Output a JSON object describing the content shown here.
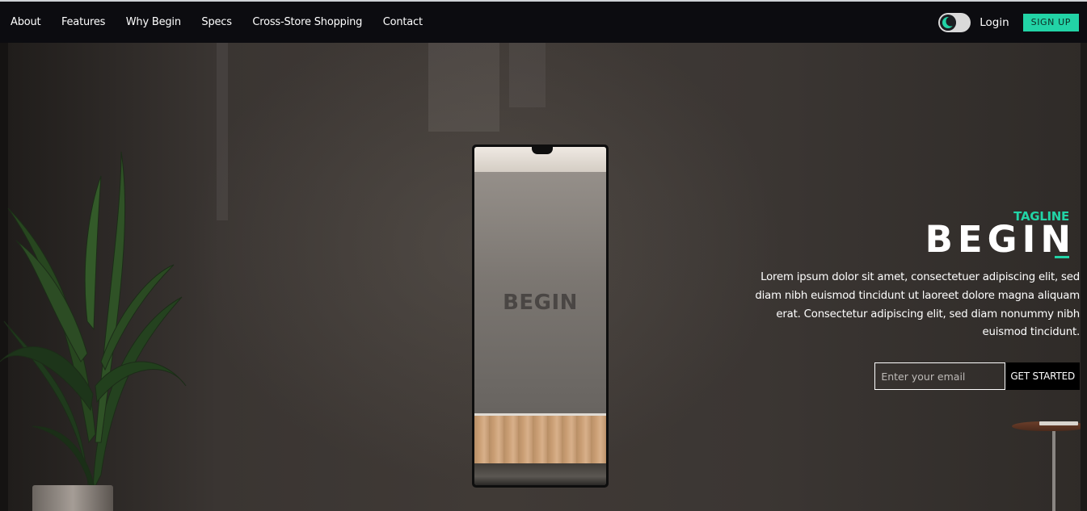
{
  "nav": {
    "links": [
      "About",
      "Features",
      "Why Begin",
      "Specs",
      "Cross-Store Shopping",
      "Contact"
    ],
    "login_label": "Login",
    "signup_label": "SIGN UP",
    "theme_toggle_icon": "moon-icon",
    "accent_color": "#22d3a6"
  },
  "hero": {
    "tagline": "TAGLINE",
    "title": "BEGIN",
    "description": "Lorem ipsum dolor sit amet, consectetuer adipiscing elit, sed diam nibh euismod tincidunt ut laoreet dolore magna aliquam erat. Consectetur adipiscing elit, sed diam nonummy nibh euismod tincidunt.",
    "email_placeholder": "Enter your email",
    "cta_label": "GET STARTED",
    "mirror_logo": "BEGIN"
  }
}
